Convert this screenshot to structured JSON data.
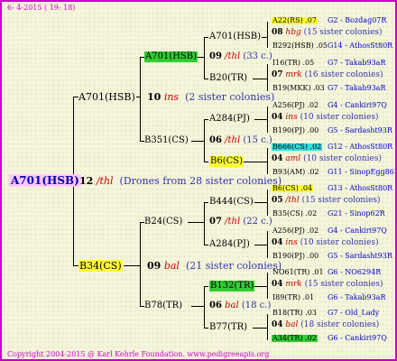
{
  "header": {
    "date": "6-  4-2015 ( 19: 18)"
  },
  "footer": {
    "text": "Copyright 2004-2015 @ Karl Kehrle Foundation.   www.pedigreeapis.org"
  },
  "root": {
    "name": "A701(HSB)",
    "num": "12",
    "ins": "/thl",
    "note": "(Drones from 28 sister colonies)"
  },
  "g1": {
    "a": {
      "name": "A701(HSB)",
      "num": "10",
      "ins": "ins",
      "note": "(2 sister colonies)"
    },
    "b": {
      "name": "B34(CS)",
      "num": "09",
      "ins": "bal",
      "note": "(21 sister colonies)"
    }
  },
  "g2": {
    "aa": {
      "name": "A701(HSB)",
      "num": "09",
      "ins": "/thl",
      "note": "(33 c.)"
    },
    "ab": {
      "name": "B351(CS)",
      "num": "06",
      "ins": "/thl",
      "note": "(15 c.)"
    },
    "ba": {
      "name": "B24(CS)",
      "num": "07",
      "ins": "/thl",
      "note": "(22 c.)"
    },
    "bb": {
      "name": "B78(TR)",
      "num": "06",
      "ins": "bal",
      "note": "(18 c.)"
    }
  },
  "g3": {
    "a1": "A701(HSB)",
    "a2": "B20(TR)",
    "a3": "A284(PJ)",
    "a4": "B6(CS)",
    "b1": "B444(CS)",
    "b2": "A284(PJ)",
    "b3": "B132(TR)",
    "b4": "B77(TR)"
  },
  "g4": [
    {
      "top": "A22(RS) .07",
      "tl": "G2 - Bozdag07R",
      "num": "08",
      "ins": "hbg",
      "note": "(15 sister colonies)",
      "bot": "B292(HSB) .05",
      "bl": "G14 - AthosSt80R"
    },
    {
      "top": "I16(TR) .05",
      "tl": "G7 - Takab93aR",
      "num": "07",
      "ins": "mrk",
      "note": "(16 sister colonies)",
      "bot": "B19(MKK) .03",
      "bl": "G7 - Takab93aR"
    },
    {
      "top": "A256(PJ) .02",
      "tl": "G4 - Cankiri97Q",
      "num": "04",
      "ins": "ins",
      "note": "(10 sister colonies)",
      "bot": "B190(PJ) .00",
      "bl": "G5 - Sardasht93R"
    },
    {
      "top": "B666(CS) .02",
      "tl": "G12 - AthosSt80R",
      "num": "04",
      "ins": "aml",
      "note": "(10 sister colonies)",
      "bot": "B93(AM) .02",
      "bl": "G11 - SinopEgg86R"
    },
    {
      "top": "B6(CS) .04",
      "tl": "G13 - AthosSt80R",
      "num": "05",
      "ins": "/thl",
      "note": "(15 sister colonies)",
      "bot": "B35(CS) .02",
      "bl": "G21 - Sinop62R"
    },
    {
      "top": "A256(PJ) .02",
      "tl": "G4 - Cankiri97Q",
      "num": "04",
      "ins": "ins",
      "note": "(10 sister colonies)",
      "bot": "B190(PJ) .00",
      "bl": "G5 - Sardasht93R"
    },
    {
      "top": "NO61(TR) .01",
      "tl": "G6 - NO6294R",
      "num": "04",
      "ins": "mrk",
      "note": "(15 sister colonies)",
      "bot": "I89(TR) .01",
      "bl": "G6 - Takab93aR"
    },
    {
      "top": "B18(TR) .03",
      "tl": "G7 - Old_Lady",
      "num": "04",
      "ins": "bal",
      "note": "(18 sister colonies)",
      "bot": "A34(TR) .02",
      "bl": "G6 - Cankiri97Q"
    }
  ]
}
